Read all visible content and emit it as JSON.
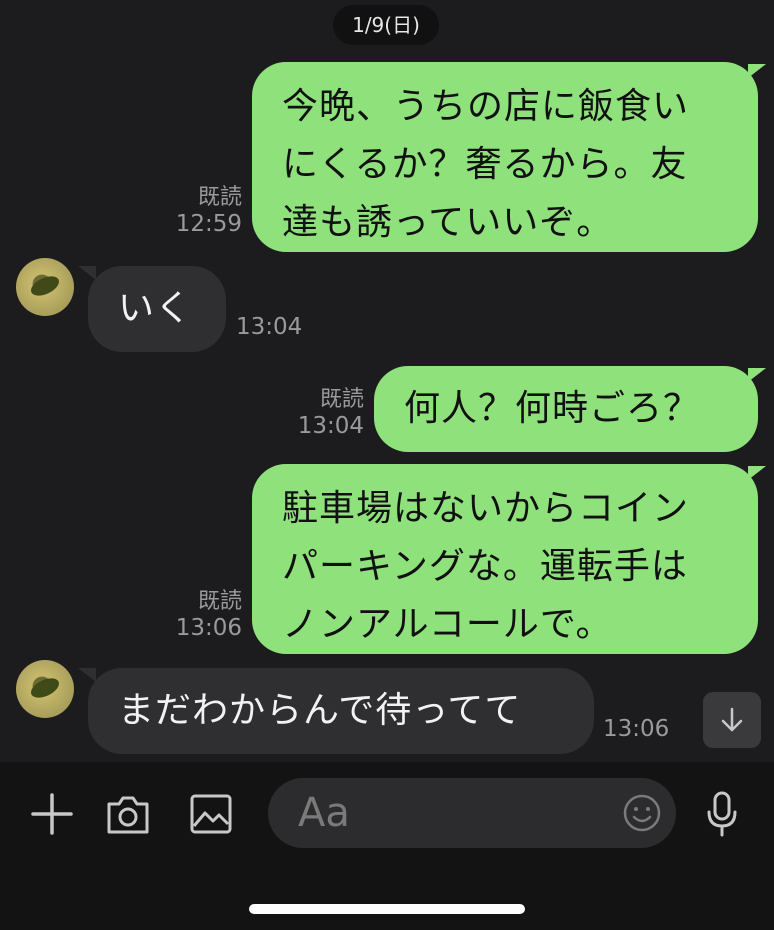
{
  "date_label": "1/9(日)",
  "messages": [
    {
      "side": "out",
      "lines": [
        "今晩、うちの店に飯食い",
        "にくるか？奢るから。友",
        "達も誘っていいぞ。"
      ],
      "read": "既読",
      "time": "12:59"
    },
    {
      "side": "in",
      "text": "いく",
      "time": "13:04"
    },
    {
      "side": "out",
      "lines": [
        "何人？何時ごろ？"
      ],
      "read": "既読",
      "time": "13:04"
    },
    {
      "side": "out",
      "lines": [
        "駐車場はないからコイン",
        "パーキングな。運転手は",
        "ノンアルコールで。"
      ],
      "read": "既読",
      "time": "13:06"
    },
    {
      "side": "in",
      "text": "まだわからんで待ってて",
      "time": "13:06"
    }
  ],
  "input": {
    "placeholder": "Aa"
  },
  "icons": {
    "plus": "plus-icon",
    "camera": "camera-icon",
    "image": "image-icon",
    "emoji": "emoji-icon",
    "mic": "microphone-icon",
    "scroll": "arrow-down-icon"
  },
  "colors": {
    "out_bubble": "#8fe17c",
    "in_bubble": "#2f2f31",
    "background": "#1c1c1e"
  }
}
